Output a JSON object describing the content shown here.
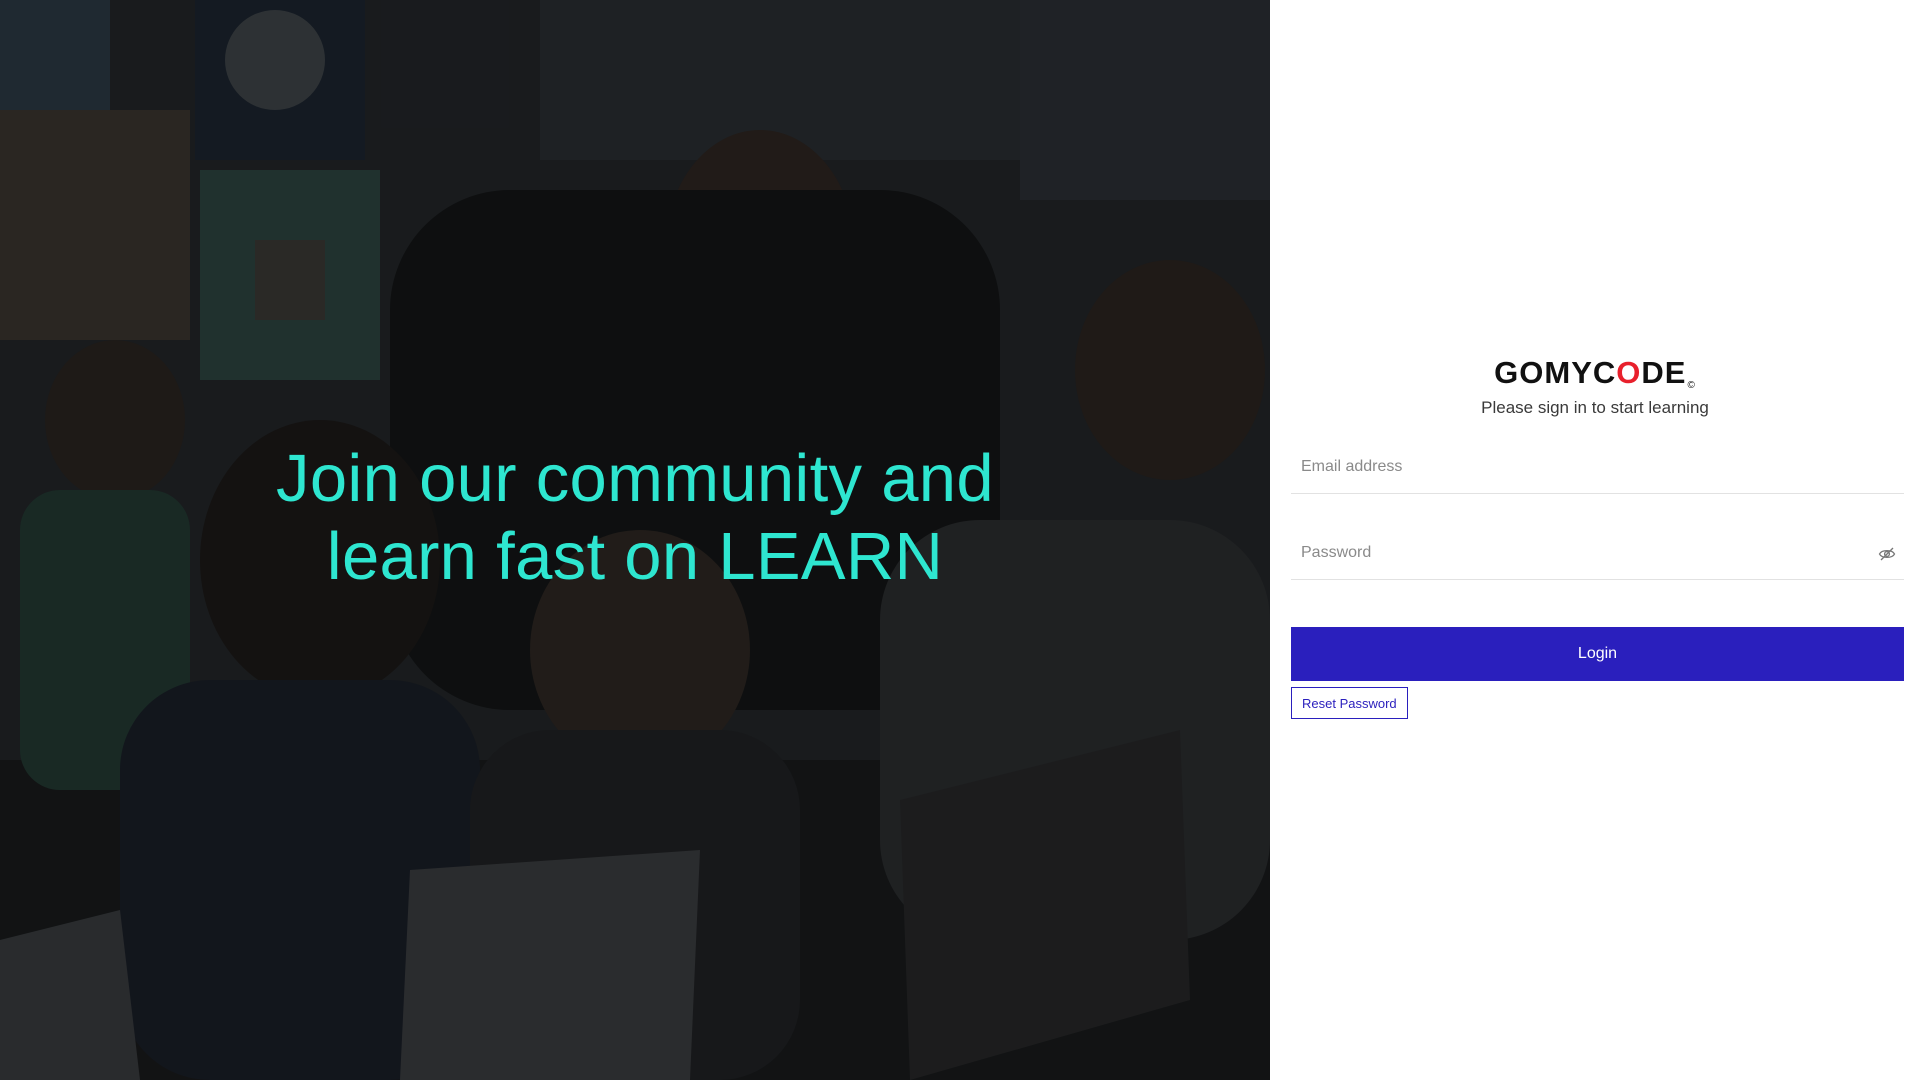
{
  "hero": {
    "headline_line1": "Join our community and",
    "headline_line2": "learn fast on LEARN",
    "headline_color": "#2ee6d0",
    "background_image": "classroom-photo"
  },
  "brand": {
    "logo_part1": "GOMYC",
    "logo_o": "O",
    "logo_part2": "DE",
    "logo_mark": "©",
    "logo_accent_color": "#e8202c"
  },
  "login": {
    "subtitle": "Please sign in to start learning",
    "email_placeholder": "Email address",
    "email_value": "",
    "password_placeholder": "Password",
    "password_value": "",
    "password_toggle_icon": "eye-off-icon",
    "login_label": "Login",
    "reset_label": "Reset Password",
    "primary_color": "#2a1fbd"
  }
}
